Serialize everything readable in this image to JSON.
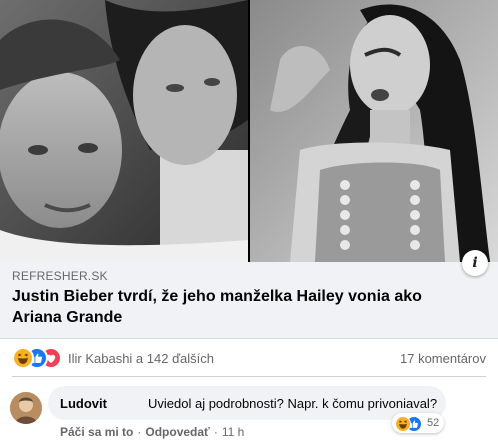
{
  "post": {
    "link_preview": {
      "domain": "REFRESHER.SK",
      "headline": "Justin Bieber tvrdí, že jeho manželka Hailey vonia ako Ariana Grande"
    },
    "reactions": {
      "summary": "Ilir Kabashi a 142 ďalších",
      "types": [
        "haha-icon",
        "like-icon",
        "love-icon"
      ],
      "comments_count": "17 komentárov"
    },
    "comment": {
      "author": "Ludovit",
      "text": "Uviedol aj podrobnosti? Napr. k čomu privoniaval?",
      "reaction_count": "52",
      "reaction_types": [
        "haha-icon",
        "like-icon"
      ],
      "actions": {
        "like": "Páči sa mi to",
        "reply": "Odpovedať",
        "time": "11 h",
        "separator": "·"
      }
    }
  },
  "colors": {
    "like": "#1877f2",
    "love": "#f33e58",
    "haha": "#f7b125",
    "meta_text": "#65676b"
  }
}
